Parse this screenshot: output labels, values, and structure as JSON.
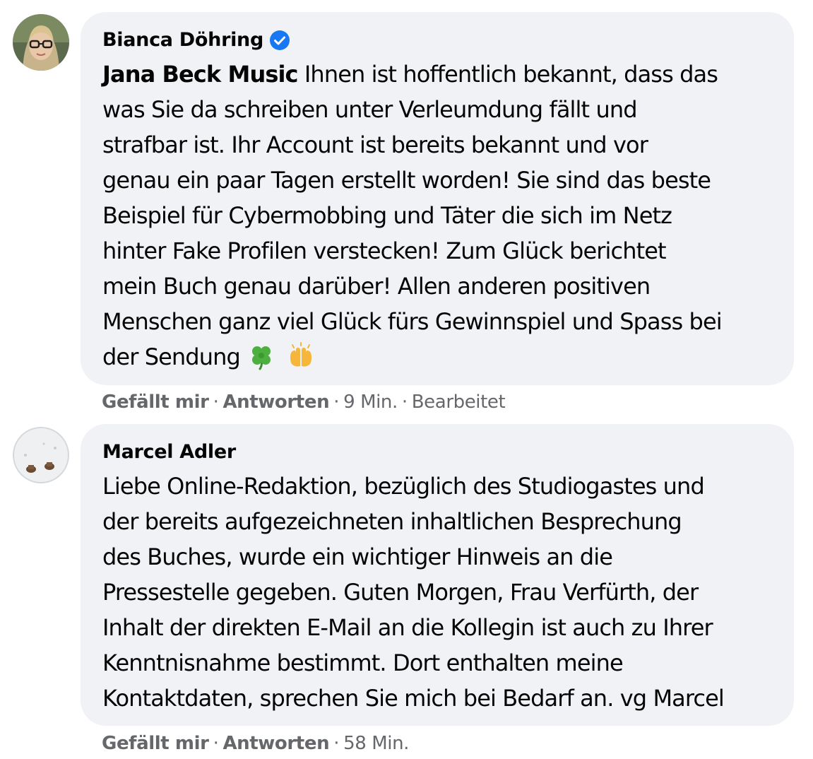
{
  "comments": [
    {
      "author": "Bianca Döhring",
      "verified": true,
      "avatar": "woman-with-glasses-avatar",
      "mention": "Jana Beck Music",
      "text": " Ihnen ist hoffentlich bekannt, dass das\nwas Sie da schreiben unter Verleumdung fällt und\nstrafbar ist. Ihr Account ist bereits bekannt und vor\ngenau ein paar Tagen erstellt worden! Sie sind das beste\nBeispiel für Cybermobbing und Täter die sich im Netz\nhinter Fake Profilen verstecken! Zum Glück berichtet\nmein Buch genau darüber! Allen anderen positiven\nMenschen ganz viel Glück fürs Gewinnspiel und Spass bei\nder Sendung",
      "emojis": [
        "four-leaf-clover",
        "raising-hands"
      ],
      "actions": {
        "like": "Gefällt mir",
        "reply": "Antworten",
        "time": "9 Min.",
        "edited": "Bearbeitet",
        "separator": "·"
      }
    },
    {
      "author": "Marcel Adler",
      "verified": false,
      "avatar": "snow-shoes-avatar",
      "text": "Liebe Online-Redaktion, bezüglich des Studiogastes und\nder bereits aufgezeichneten inhaltlichen Besprechung\ndes Buches, wurde ein wichtiger Hinweis an die\nPressestelle gegeben. Guten Morgen, Frau Verfürth, der\nInhalt der direkten E-Mail an die Kollegin ist auch zu Ihrer\nKenntnisnahme bestimmt. Dort enthalten meine\nKontaktdaten, sprechen Sie mich bei Bedarf an. vg Marcel",
      "actions": {
        "like": "Gefällt mir",
        "reply": "Antworten",
        "time": "58 Min.",
        "separator": "·"
      }
    }
  ],
  "colors": {
    "bubble": "#f0f2f5",
    "text": "#050505",
    "meta": "#65676b",
    "verified": "#1877f2"
  }
}
